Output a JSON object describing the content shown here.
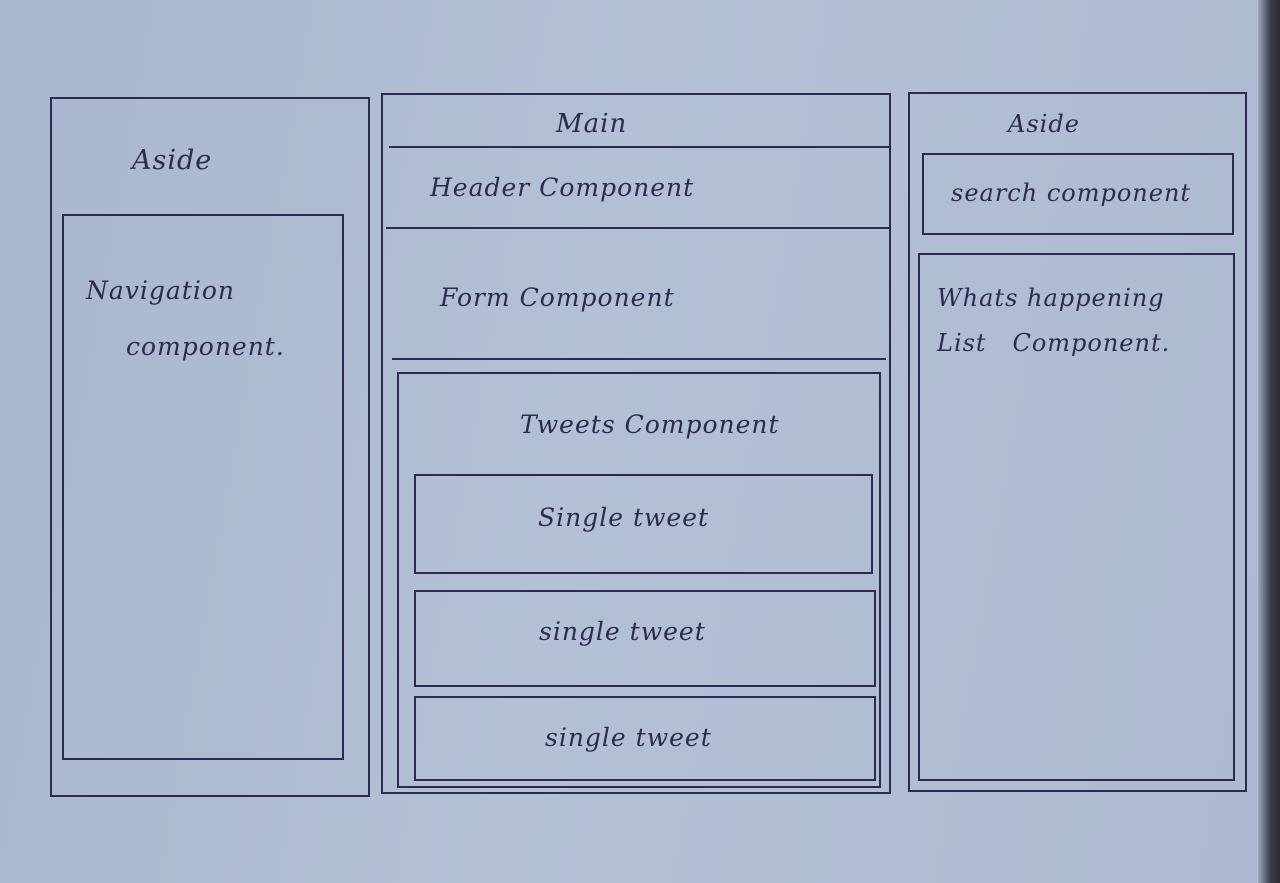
{
  "left_aside": {
    "title": "Aside",
    "navigation": {
      "line1": "Navigation",
      "line2": "component."
    }
  },
  "main": {
    "title": "Main",
    "header": "Header Component",
    "form": "Form Component",
    "tweets": {
      "title": "Tweets Component",
      "items": [
        "Single tweet",
        "single tweet",
        "single tweet"
      ]
    }
  },
  "right_aside": {
    "title": "Aside",
    "search": "search component",
    "whats_happening": {
      "line1": "Whats happening",
      "line2": "List   Component."
    }
  }
}
